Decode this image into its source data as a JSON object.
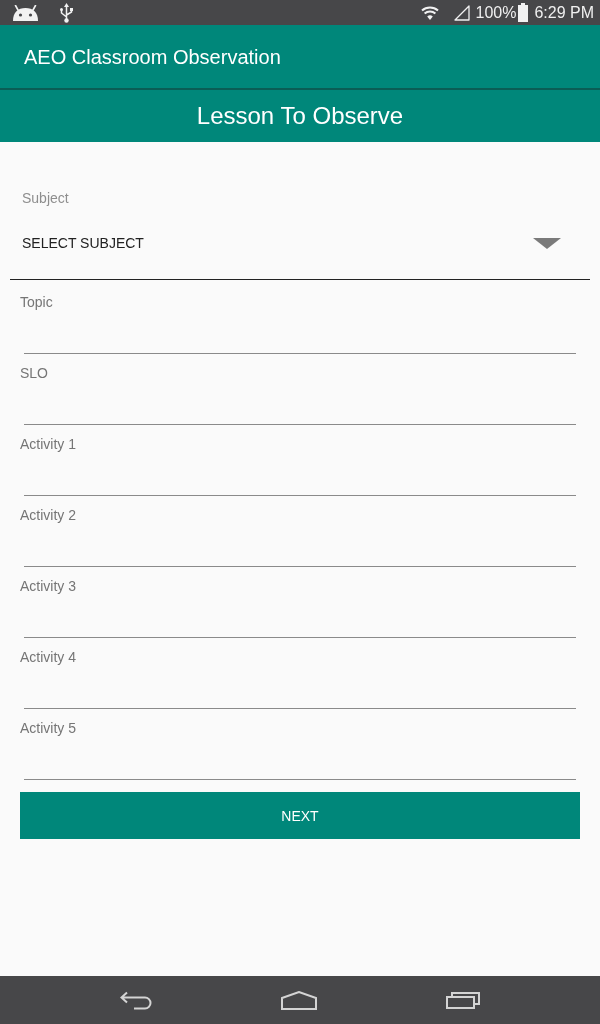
{
  "status_bar": {
    "battery_text": "100%",
    "time": "6:29 PM"
  },
  "app_bar": {
    "title": "AEO Classroom Observation"
  },
  "section_header": {
    "title": "Lesson To Observe"
  },
  "subject": {
    "label": "Subject",
    "value": "SELECT SUBJECT"
  },
  "fields": [
    {
      "label": "Topic"
    },
    {
      "label": "SLO"
    },
    {
      "label": "Activity 1"
    },
    {
      "label": "Activity 2"
    },
    {
      "label": "Activity 3"
    },
    {
      "label": "Activity 4"
    },
    {
      "label": "Activity 5"
    }
  ],
  "next_button": {
    "label": "NEXT"
  }
}
